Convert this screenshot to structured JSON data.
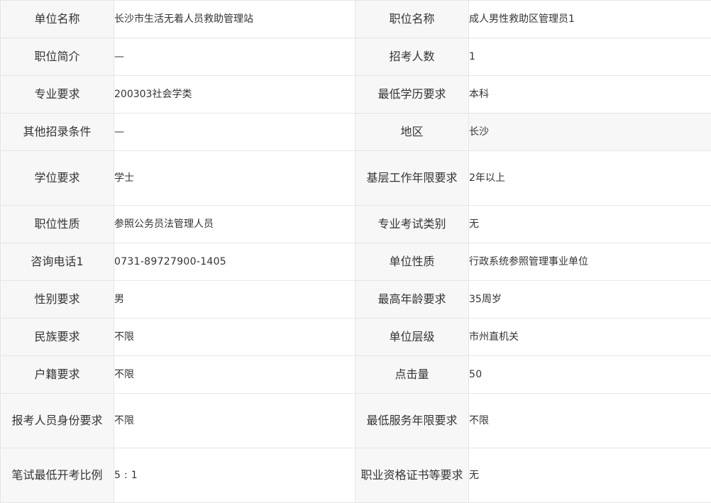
{
  "rows": [
    {
      "l1": "单位名称",
      "v1": "长沙市生活无着人员救助管理站",
      "l2": "职位名称",
      "v2": "成人男性救助区管理员1"
    },
    {
      "l1": "职位简介",
      "v1": "—",
      "l2": "招考人数",
      "v2": "1"
    },
    {
      "l1": "专业要求",
      "v1": "200303社会学类",
      "l2": "最低学历要求",
      "v2": "本科"
    },
    {
      "l1": "其他招录条件",
      "v1": "—",
      "l2": "地区",
      "v2": "长沙"
    },
    {
      "l1": "学位要求",
      "v1": "学士",
      "l2": "基层工作年限要求",
      "v2": "2年以上"
    },
    {
      "l1": "职位性质",
      "v1": "参照公务员法管理人员",
      "l2": "专业考试类别",
      "v2": "无"
    },
    {
      "l1": "咨询电话1",
      "v1": "0731-89727900-1405",
      "l2": "单位性质",
      "v2": "行政系统参照管理事业单位"
    },
    {
      "l1": "性别要求",
      "v1": "男",
      "l2": "最高年龄要求",
      "v2": "35周岁"
    },
    {
      "l1": "民族要求",
      "v1": "不限",
      "l2": "单位层级",
      "v2": "市州直机关"
    },
    {
      "l1": "户籍要求",
      "v1": "不限",
      "l2": "点击量",
      "v2": "50"
    },
    {
      "l1": "报考人员身份要求",
      "v1": "不限",
      "l2": "最低服务年限要求",
      "v2": "不限"
    },
    {
      "l1": "笔试最低开考比例",
      "v1": "5 : 1",
      "l2": "职业资格证书等要求",
      "v2": "无"
    }
  ]
}
